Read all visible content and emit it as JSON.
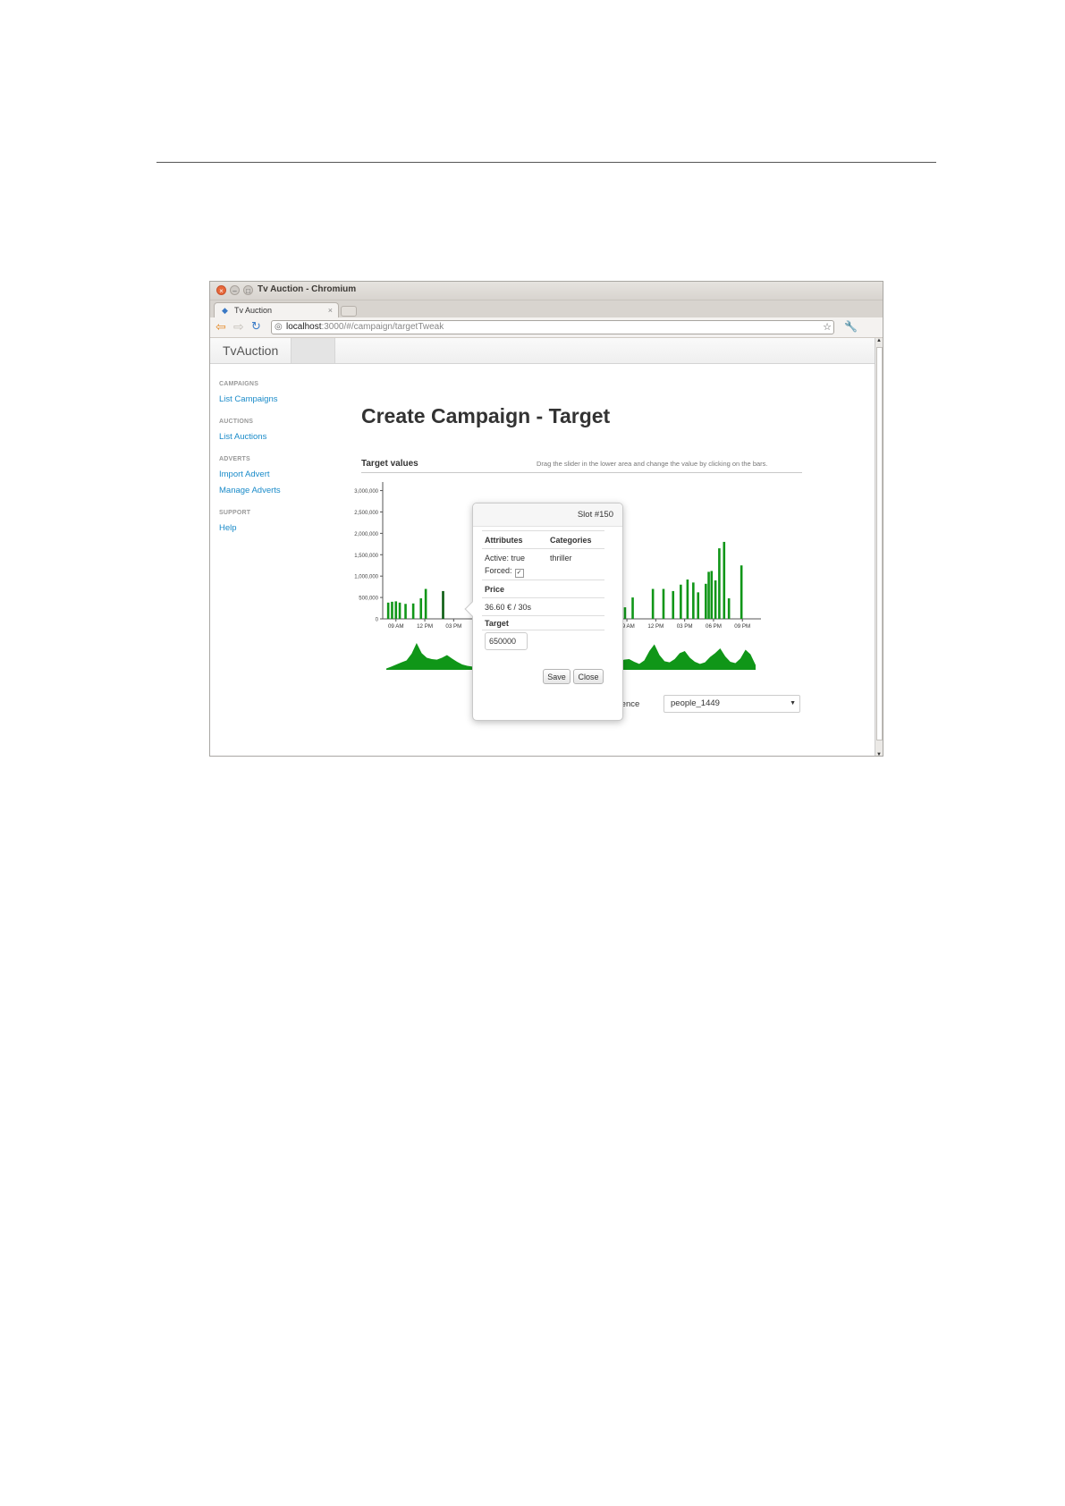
{
  "window": {
    "title": "Tv Auction - Chromium",
    "tab_title": "Tv Auction",
    "tab_close": "×",
    "url_host": "localhost",
    "url_path": ":3000/#/campaign/targetTweak"
  },
  "navbar": {
    "brand": "TvAuction"
  },
  "sidebar": {
    "sections": [
      {
        "heading": "CAMPAIGNS",
        "links": [
          "List Campaigns"
        ]
      },
      {
        "heading": "AUCTIONS",
        "links": [
          "List Auctions"
        ]
      },
      {
        "heading": "ADVERTS",
        "links": [
          "Import Advert",
          "Manage Adverts"
        ]
      },
      {
        "heading": "SUPPORT",
        "links": [
          "Help"
        ]
      }
    ]
  },
  "main": {
    "title": "Create Campaign - Target",
    "section_title": "Target values",
    "section_hint": "Drag the slider in the lower area and change the value by clicking on the bars.",
    "audience_label": "udience",
    "audience_value": "people_1449"
  },
  "popover": {
    "title": "Slot #150",
    "col_attributes": "Attributes",
    "col_categories": "Categories",
    "active": "Active: true",
    "forced": "Forced:",
    "category": "thriller",
    "price_label": "Price",
    "price_value": "36.60 € / 30s",
    "target_label": "Target",
    "target_value": "650000",
    "save": "Save",
    "close": "Close"
  },
  "colors": {
    "bar": "#109618",
    "bar_selected": "#0a5c10",
    "link": "#1a8bc9"
  },
  "chart_data": {
    "type": "bar",
    "ylim": [
      0,
      3200000
    ],
    "y_ticks": [
      0,
      500000,
      1000000,
      1500000,
      2000000,
      2500000,
      3000000
    ],
    "y_tick_labels": [
      "0",
      "500,000",
      "1,000,000",
      "1,500,000",
      "2,000,000",
      "2,500,000",
      "3,000,000"
    ],
    "x_range_hours": [
      7,
      31
    ],
    "x_ticks_hours": [
      9,
      12,
      15,
      18,
      21,
      24,
      27,
      30
    ],
    "x_tick_labels": [
      "09 AM",
      "12 PM",
      "03 PM",
      "06 PM",
      "09 PM",
      "12 AM",
      "03 AM",
      "06 AM",
      "09 AM",
      "12 PM",
      "03 PM",
      "06 PM",
      "09 PM"
    ],
    "x_tick_hours_full": [
      9,
      12,
      15,
      18,
      21,
      24,
      27,
      30,
      33,
      36,
      39,
      42,
      45
    ],
    "x_span_hours": [
      8,
      46
    ],
    "selected_hour": 13.9,
    "bars": [
      {
        "hour": 8.2,
        "value": 380000
      },
      {
        "hour": 8.6,
        "value": 400000
      },
      {
        "hour": 9.0,
        "value": 410000
      },
      {
        "hour": 9.4,
        "value": 380000
      },
      {
        "hour": 10.0,
        "value": 350000
      },
      {
        "hour": 10.8,
        "value": 360000
      },
      {
        "hour": 11.6,
        "value": 480000
      },
      {
        "hour": 12.1,
        "value": 700000
      },
      {
        "hour": 13.9,
        "value": 650000
      },
      {
        "hour": 29.4,
        "value": 330000
      },
      {
        "hour": 30.4,
        "value": 280000
      },
      {
        "hour": 30.8,
        "value": 330000
      },
      {
        "hour": 31.2,
        "value": 340000
      },
      {
        "hour": 31.6,
        "value": 330000
      },
      {
        "hour": 32.0,
        "value": 290000
      },
      {
        "hour": 32.8,
        "value": 270000
      },
      {
        "hour": 33.6,
        "value": 500000
      },
      {
        "hour": 35.7,
        "value": 700000
      },
      {
        "hour": 36.8,
        "value": 700000
      },
      {
        "hour": 37.8,
        "value": 650000
      },
      {
        "hour": 38.6,
        "value": 800000
      },
      {
        "hour": 39.3,
        "value": 920000
      },
      {
        "hour": 39.9,
        "value": 850000
      },
      {
        "hour": 40.4,
        "value": 620000
      },
      {
        "hour": 41.2,
        "value": 820000
      },
      {
        "hour": 41.5,
        "value": 1100000
      },
      {
        "hour": 41.8,
        "value": 1120000
      },
      {
        "hour": 42.2,
        "value": 900000
      },
      {
        "hour": 42.6,
        "value": 1650000
      },
      {
        "hour": 43.1,
        "value": 1800000
      },
      {
        "hour": 43.6,
        "value": 480000
      },
      {
        "hour": 44.9,
        "value": 1250000
      }
    ],
    "overview": [
      0.05,
      0.12,
      0.2,
      0.28,
      0.35,
      0.6,
      1.0,
      0.62,
      0.45,
      0.4,
      0.38,
      0.45,
      0.55,
      0.42,
      0.3,
      0.2,
      0.15,
      0.12,
      0.15,
      0.2,
      0.3,
      0.45,
      0.55,
      0.4,
      0.3,
      0.25,
      0.2,
      0.18,
      0.15,
      0.12,
      0.08,
      0.06,
      0.05,
      0.05,
      0.06,
      0.1,
      0.2,
      0.32,
      0.45,
      0.6,
      0.85,
      0.55,
      0.4,
      0.36,
      0.3,
      0.22,
      0.3,
      0.38,
      0.4,
      0.3,
      0.22,
      0.35,
      0.7,
      0.95,
      0.55,
      0.32,
      0.28,
      0.4,
      0.62,
      0.7,
      0.45,
      0.3,
      0.22,
      0.28,
      0.48,
      0.62,
      0.8,
      0.5,
      0.3,
      0.25,
      0.42,
      0.75,
      0.58,
      0.18
    ]
  }
}
